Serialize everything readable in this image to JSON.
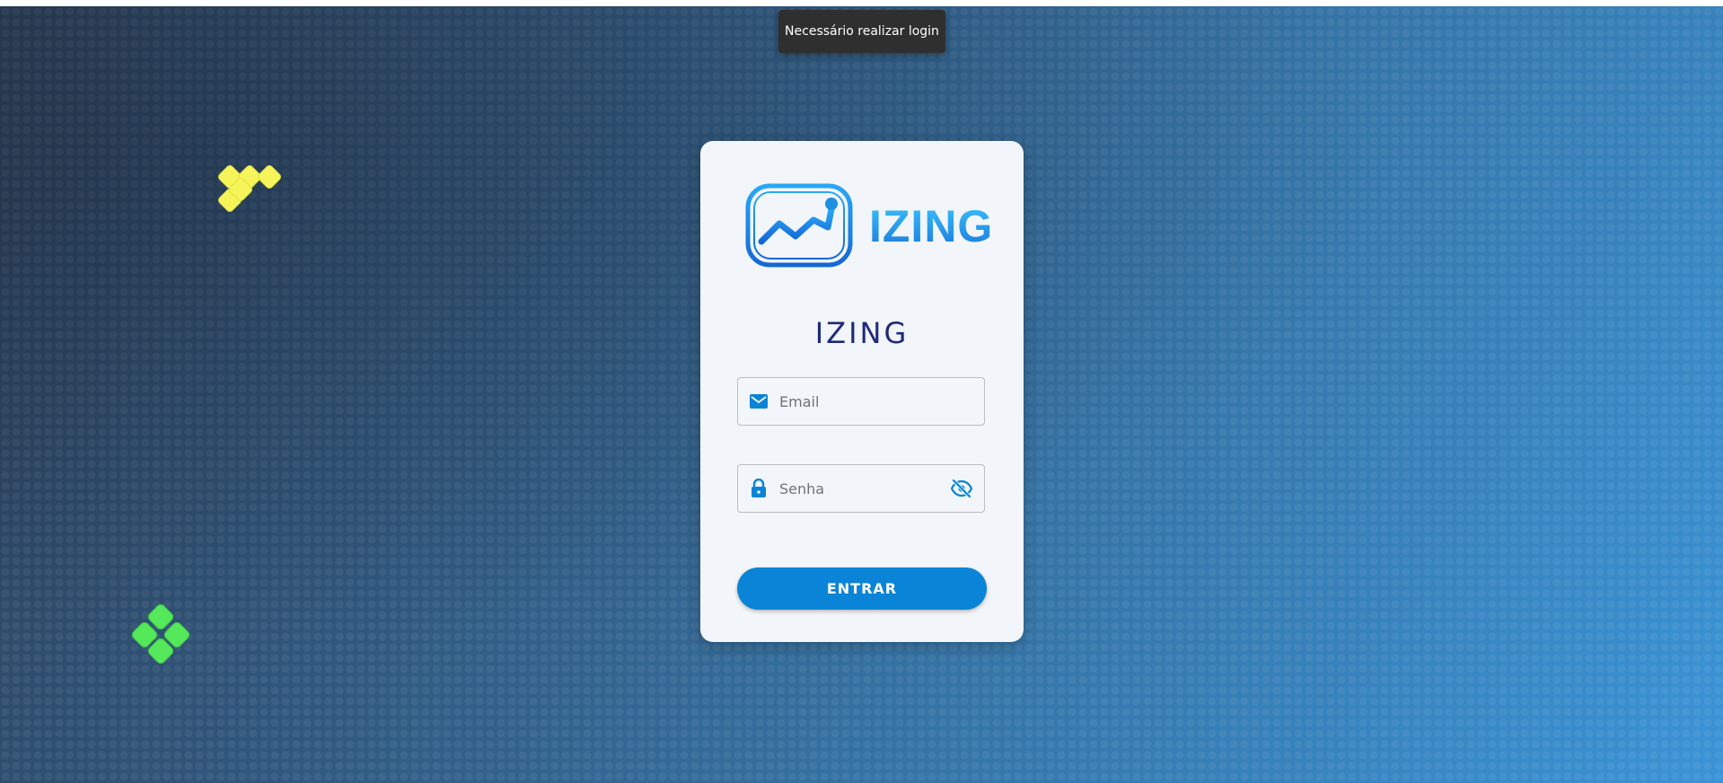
{
  "toast": {
    "message": "Necessário realizar login"
  },
  "login": {
    "logo_text": "IZING",
    "title": "IZING",
    "email": {
      "placeholder": "Email",
      "value": "",
      "icon": "mail-icon"
    },
    "password": {
      "placeholder": "Senha",
      "value": "",
      "icon": "lock-icon",
      "toggle_icon": "eye-off-icon"
    },
    "submit_label": "ENTRAR"
  },
  "colors": {
    "accent": "#0a84d6",
    "title": "#1e2a78",
    "toast_bg": "#2f2f2f",
    "deco_yellow": "#f5f55a",
    "deco_green": "#55e85a"
  }
}
